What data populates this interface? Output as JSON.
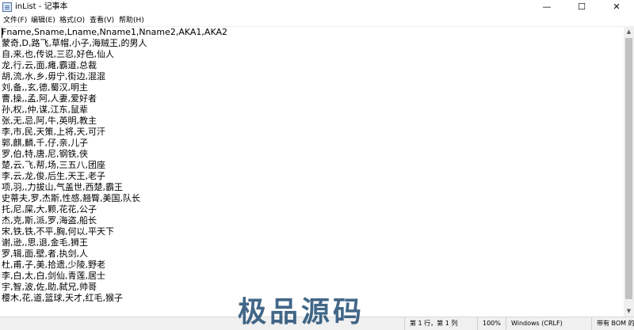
{
  "window": {
    "title": "inList - 记事本",
    "minimize_glyph": "—",
    "maximize_glyph": "☐",
    "close_glyph": "✕"
  },
  "menu": {
    "items": [
      "文件(F)",
      "编辑(E)",
      "格式(O)",
      "查看(V)",
      "帮助(H)"
    ]
  },
  "editor": {
    "lines": [
      "Fname,Sname,Lname,Nname1,Nname2,AKA1,AKA2",
      "蒙奇,D,路飞,草帽,小子,海贼王,的男人",
      "自,来,也,传说,三忍,好色,仙人",
      "龙,行,云,面,瘫,霸道,总裁",
      "胡,流,水,乡,毋宁,街边,混混",
      "刘,备,,玄,德,蜀汉,明主",
      "曹,操,,孟,阿,人妻,爱好者",
      "孙,权,,仲,谋,江东,鼠辈",
      "张,无,忌,阿,牛,英明,教主",
      "李,市,民,天策,上将,天,可汗",
      "郭,麒,麟,千,仔,亲,儿子",
      "罗,伯,特,唐,尼,钢铁,侠",
      "楚,云,飞,帮,场,三五八,团座",
      "李,云,龙,俊,后生,天王,老子",
      "项,羽,,力拔山,气盖世,西楚,霸王",
      "史蒂夫,罗,杰斯,性感,翘臀,美国,队长",
      "托,尼,屎,大,颗,花花,公子",
      "杰,克,斯,派,罗,海盗,船长",
      "宋,铁,铁,不平,胸,何以,平天下",
      "谢,逊,,思,退,金毛,狮王",
      "罗,辑,面,壁,者,执剑,人",
      "杜,甫,子,美,拾遗,少陵,野老",
      "李,白,太,白,剑仙,青莲,居士",
      "宇,智,波,佐,助,弑兄,帅哥",
      "樱木,花,道,篮球,天才,红毛,猴子"
    ]
  },
  "scrollbar": {
    "up_glyph": "▲",
    "down_glyph": "▼"
  },
  "status": {
    "position": "第 1 行，第 1 列",
    "zoom": "100%",
    "line_ending": "Windows (CRLF)",
    "encoding": "带有 BOM 的 UT"
  },
  "watermark": {
    "text": "极品源码"
  }
}
